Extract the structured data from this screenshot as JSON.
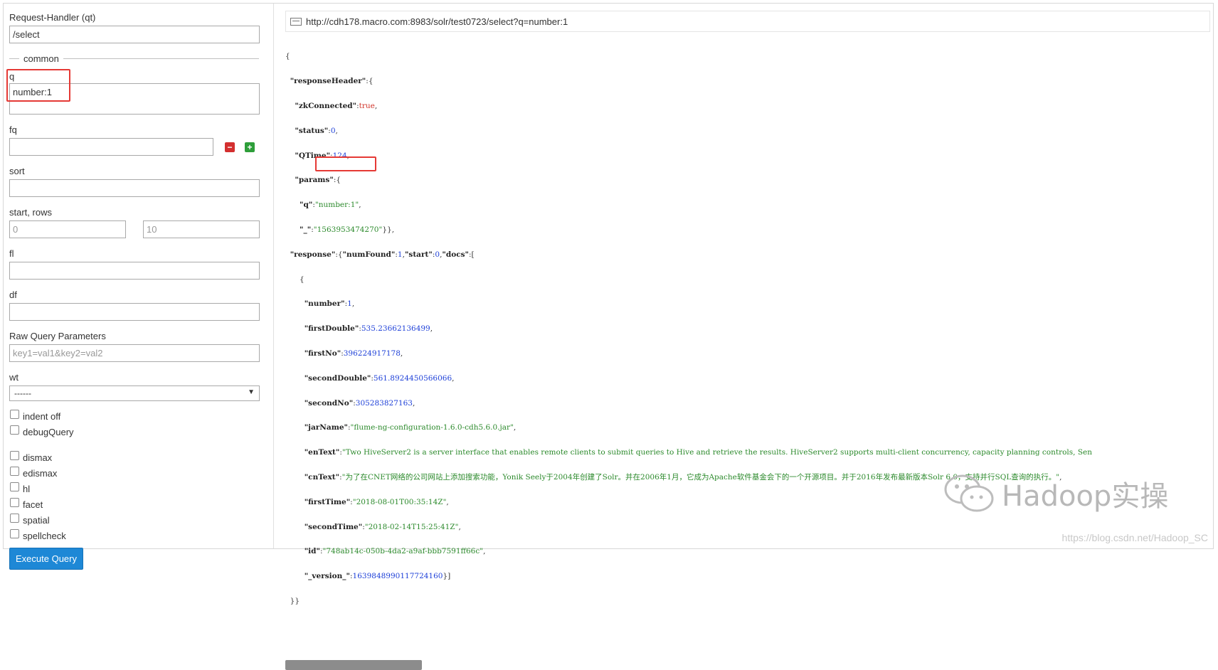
{
  "sidebar": {
    "request_handler": {
      "label": "Request-Handler (qt)",
      "value": "/select"
    },
    "common_legend": "common",
    "q": {
      "label": "q",
      "value": "number:1"
    },
    "fq": {
      "label": "fq",
      "value": ""
    },
    "sort": {
      "label": "sort",
      "value": ""
    },
    "start_rows": {
      "label": "start, rows",
      "start_placeholder": "0",
      "rows_placeholder": "10"
    },
    "fl": {
      "label": "fl",
      "value": ""
    },
    "df": {
      "label": "df",
      "value": ""
    },
    "raw": {
      "label": "Raw Query Parameters",
      "placeholder": "key1=val1&key2=val2"
    },
    "wt": {
      "label": "wt",
      "selected": "------"
    },
    "checks": [
      {
        "label": "indent off"
      },
      {
        "label": "debugQuery"
      }
    ],
    "parsers": [
      {
        "label": "dismax"
      },
      {
        "label": "edismax"
      },
      {
        "label": "hl"
      },
      {
        "label": "facet"
      },
      {
        "label": "spatial"
      },
      {
        "label": "spellcheck"
      }
    ],
    "execute_label": "Execute Query"
  },
  "main": {
    "url": "http://cdh178.macro.com:8983/solr/test0723/select?q=number:1",
    "response": {
      "zkConnected": "true",
      "status": "0",
      "QTime": "124",
      "q": "number:1",
      "underscore": "1563953474270",
      "numFound": "1",
      "start": "0",
      "doc": {
        "number": "1",
        "firstDouble": "535.23662136499",
        "firstNo": "396224917178",
        "secondDouble": "561.8924450566066",
        "secondNo": "305283827163",
        "jarName": "flume-ng-configuration-1.6.0-cdh5.6.0.jar",
        "enText": "Two HiveServer2 is a server interface that enables remote clients to submit queries to Hive and retrieve the results. HiveServer2 supports multi-client concurrency, capacity planning controls, Sen",
        "cnText": "为了在CNET网络的公司网站上添加搜索功能，Yonik Seely于2004年创建了Solr。并在2006年1月，它成为Apache软件基金会下的一个开源项目。并于2016年发布最新版本Solr 6.0，支持并行SQL查询的执行。",
        "firstTime": "2018-08-01T00:35:14Z",
        "secondTime": "2018-02-14T15:25:41Z",
        "id": "748ab14c-050b-4da2-a9af-bbb7591ff66c",
        "version": "1639848990117724160"
      }
    }
  },
  "watermark": {
    "brand": "Hadoop实操",
    "url": "https://blog.csdn.net/Hadoop_SC"
  },
  "colors": {
    "highlight": "#e53935",
    "button": "#1e88d6",
    "string": "#2c8a2c",
    "number": "#1e40d8",
    "boolean": "#d2352b"
  }
}
